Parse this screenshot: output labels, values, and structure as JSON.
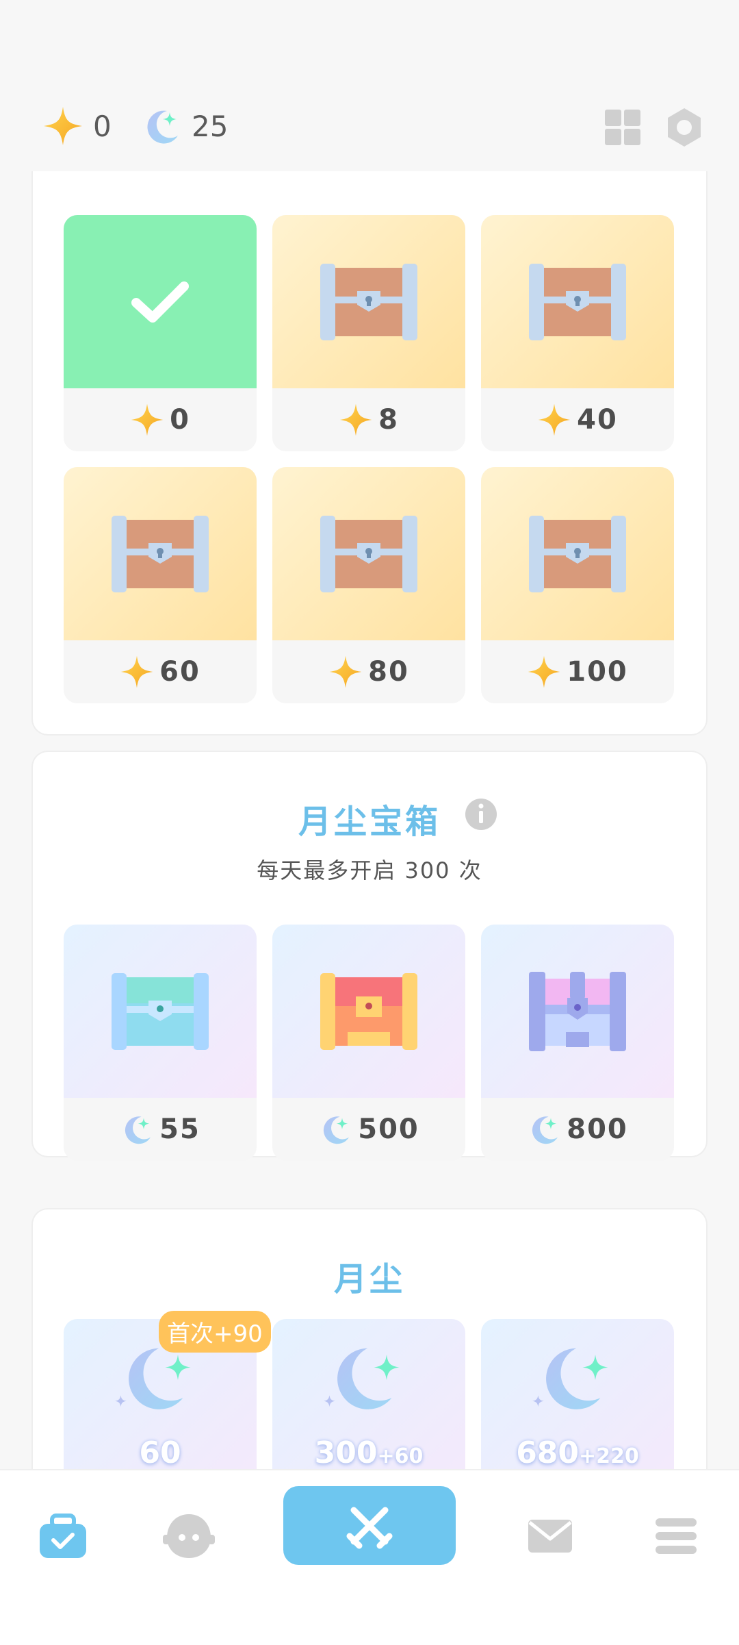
{
  "header": {
    "stars_count": "0",
    "moondust_count": "25",
    "icons": [
      "star-icon",
      "moon-icon",
      "grid-icon",
      "settings-icon"
    ]
  },
  "star_chests": {
    "tiles": [
      {
        "price": "0",
        "state": "claimed"
      },
      {
        "price": "8",
        "state": "locked"
      },
      {
        "price": "40",
        "state": "locked"
      },
      {
        "price": "60",
        "state": "locked"
      },
      {
        "price": "80",
        "state": "locked"
      },
      {
        "price": "100",
        "state": "locked"
      }
    ]
  },
  "moondust_chests": {
    "title": "月尘宝箱",
    "subtitle": "每天最多开启 300 次",
    "tiles": [
      {
        "price": "55"
      },
      {
        "price": "500"
      },
      {
        "price": "800"
      }
    ]
  },
  "moondust_shop": {
    "title": "月尘",
    "badge": "首次+90",
    "items": [
      {
        "amount": "60",
        "bonus": ""
      },
      {
        "amount": "300",
        "bonus": "+60"
      },
      {
        "amount": "680",
        "bonus": "+220"
      }
    ]
  },
  "colors": {
    "accent": "#6ec6ef",
    "claimed": "#88f0b3",
    "gold_tile": "#ffe2a1",
    "badge": "#ffc35a"
  }
}
